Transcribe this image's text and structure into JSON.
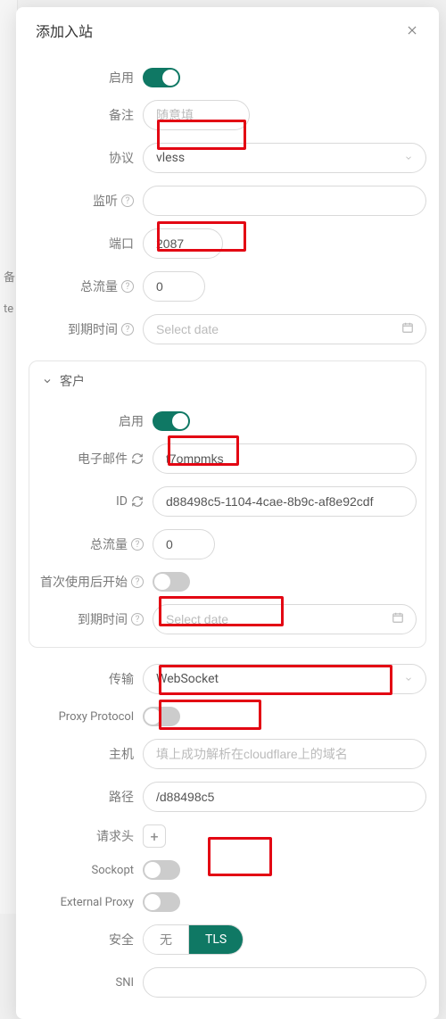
{
  "modal": {
    "title": "添加入站",
    "close_icon": "close-icon"
  },
  "form": {
    "enable_label": "启用",
    "remark_label": "备注",
    "remark_placeholder": "随意填",
    "protocol_label": "协议",
    "protocol_value": "vless",
    "listen_label": "监听",
    "port_label": "端口",
    "port_value": "2087",
    "total_label": "总流量",
    "total_value": "0",
    "expiry_label": "到期时间",
    "expiry_placeholder": "Select date"
  },
  "client": {
    "panel_title": "客户",
    "enable_label": "启用",
    "email_label": "电子邮件",
    "email_value": "t7ompmks",
    "id_label": "ID",
    "id_value": "d88498c5-1104-4cae-8b9c-af8e92cdf",
    "total_label": "总流量",
    "total_value": "0",
    "start_label": "首次使用后开始",
    "expiry_label": "到期时间",
    "expiry_placeholder": "Select date"
  },
  "transport": {
    "label": "传输",
    "value": "WebSocket",
    "proxy_protocol_label": "Proxy Protocol",
    "host_label": "主机",
    "host_placeholder": "填上成功解析在cloudflare上的域名",
    "path_label": "路径",
    "path_value": "/d88498c5",
    "headers_label": "请求头",
    "sockopt_label": "Sockopt",
    "external_proxy_label": "External Proxy",
    "security_label": "安全",
    "security_options": {
      "none": "无",
      "tls": "TLS"
    },
    "sni_label": "SNI"
  }
}
